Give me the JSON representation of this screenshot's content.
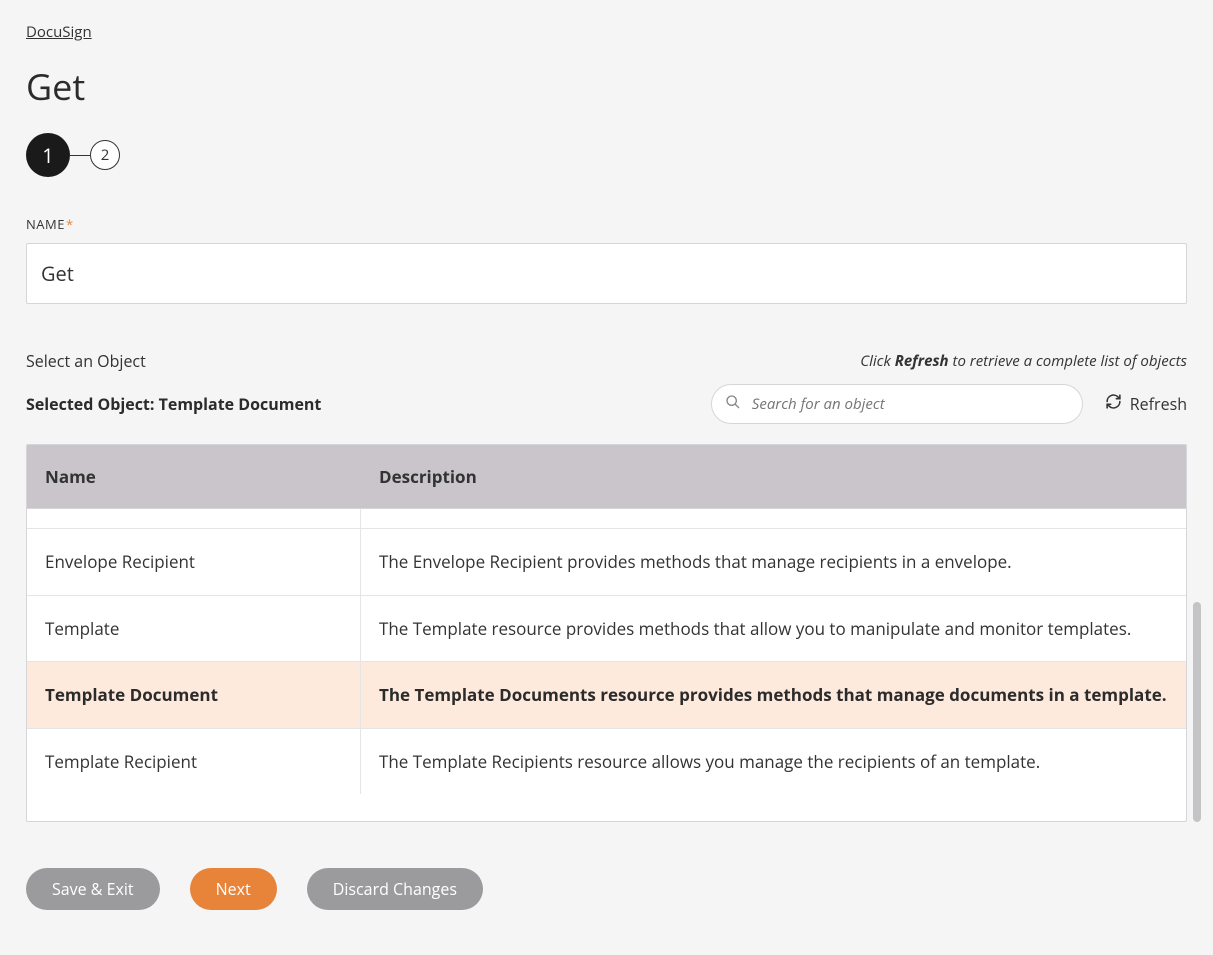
{
  "breadcrumb": "DocuSign",
  "page_title": "Get",
  "stepper": {
    "step1": "1",
    "step2": "2"
  },
  "name_field": {
    "label": "NAME",
    "required_mark": "*",
    "value": "Get"
  },
  "object_section": {
    "select_label": "Select an Object",
    "hint_prefix": "Click ",
    "hint_bold": "Refresh",
    "hint_suffix": " to retrieve a complete list of objects",
    "selected_prefix": "Selected Object: ",
    "selected_value": "Template Document",
    "search_placeholder": "Search for an object",
    "refresh_label": "Refresh"
  },
  "table": {
    "headers": {
      "name": "Name",
      "description": "Description"
    },
    "rows": [
      {
        "name": "Envelope Recipient",
        "description": "The Envelope Recipient provides methods that manage recipients in a envelope.",
        "selected": false
      },
      {
        "name": "Template",
        "description": "The Template resource provides methods that allow you to manipulate and monitor templates.",
        "selected": false
      },
      {
        "name": "Template Document",
        "description": "The Template Documents resource provides methods that manage documents in a template.",
        "selected": true
      },
      {
        "name": "Template Recipient",
        "description": "The Template Recipients resource allows you manage the recipients of an template.",
        "selected": false
      }
    ]
  },
  "buttons": {
    "save_exit": "Save & Exit",
    "next": "Next",
    "discard": "Discard Changes"
  }
}
